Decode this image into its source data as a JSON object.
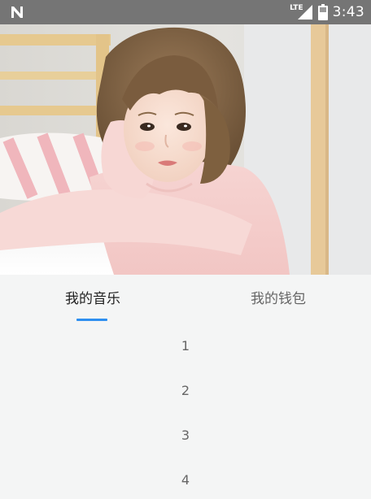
{
  "status_bar": {
    "network_type": "LTE",
    "time": "3:43",
    "icons": [
      "n-logo-icon",
      "signal-icon",
      "battery-icon"
    ]
  },
  "header_image": {
    "kind": "photo",
    "subject_icon": "girl-in-pink-sweater-photo"
  },
  "tabs": [
    {
      "label": "我的音乐",
      "selected": true
    },
    {
      "label": "我的钱包",
      "selected": false
    }
  ],
  "list": {
    "items": [
      {
        "label": "1"
      },
      {
        "label": "2"
      },
      {
        "label": "3"
      },
      {
        "label": "4"
      }
    ]
  },
  "colors": {
    "status_bar_bg": "#757575",
    "page_bg": "#f4f5f5",
    "tab_active_text": "#212121",
    "tab_inactive_text": "#666666",
    "indicator": "#2e8ff0",
    "list_text": "#666666"
  }
}
